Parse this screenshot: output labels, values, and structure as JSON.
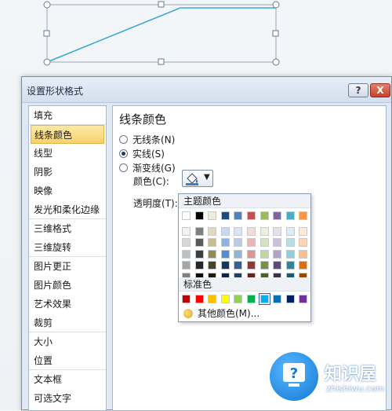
{
  "dialog": {
    "title": "设置形状格式",
    "help_label": "?",
    "close_label": "X"
  },
  "nav": {
    "items": [
      {
        "label": "填充"
      },
      {
        "label": "线条颜色",
        "active": true
      },
      {
        "label": "线型"
      },
      {
        "label": "阴影"
      },
      {
        "label": "映像"
      },
      {
        "label": "发光和柔化边缘"
      },
      {
        "label": "三维格式"
      },
      {
        "label": "三维旋转"
      },
      {
        "label": "图片更正"
      },
      {
        "label": "图片颜色"
      },
      {
        "label": "艺术效果"
      },
      {
        "label": "裁剪"
      },
      {
        "label": "大小"
      },
      {
        "label": "位置"
      },
      {
        "label": "文本框"
      },
      {
        "label": "可选文字"
      }
    ]
  },
  "panel": {
    "title": "线条颜色",
    "options": [
      {
        "label": "无线条(N)",
        "checked": false
      },
      {
        "label": "实线(S)",
        "checked": true
      },
      {
        "label": "渐变线(G)",
        "checked": false
      }
    ],
    "color_label": "颜色(C):",
    "transparency_label": "透明度(T):"
  },
  "palette": {
    "theme_header": "主题颜色",
    "standard_header": "标准色",
    "more_colors": "其他颜色(M)...",
    "theme_colors": [
      [
        "#ffffff",
        "#000000",
        "#eeece1",
        "#1f497d",
        "#4f81bd",
        "#c0504d",
        "#9bbb59",
        "#8064a2",
        "#4bacc6",
        "#f79646"
      ],
      [
        "#f2f2f2",
        "#7f7f7f",
        "#ddd9c3",
        "#c6d9f0",
        "#dbe5f1",
        "#f2dcdb",
        "#ebf1dd",
        "#e5e0ec",
        "#dbeef3",
        "#fdeada"
      ],
      [
        "#d8d8d8",
        "#595959",
        "#c4bd97",
        "#8db3e2",
        "#b8cce4",
        "#e5b9b7",
        "#d7e3bc",
        "#ccc1d9",
        "#b7dde8",
        "#fbd5b5"
      ],
      [
        "#bfbfbf",
        "#3f3f3f",
        "#938953",
        "#548dd4",
        "#95b3d7",
        "#d99694",
        "#c3d69b",
        "#b2a2c7",
        "#92cddc",
        "#fac08f"
      ],
      [
        "#a5a5a5",
        "#262626",
        "#494429",
        "#17365d",
        "#366092",
        "#953734",
        "#76923c",
        "#5f497a",
        "#31859b",
        "#e36c09"
      ],
      [
        "#7f7f7f",
        "#0c0c0c",
        "#1d1b10",
        "#0f243e",
        "#244061",
        "#632423",
        "#4f6128",
        "#3f3151",
        "#205867",
        "#974806"
      ]
    ],
    "standard_colors": [
      "#c00000",
      "#ff0000",
      "#ffc000",
      "#ffff00",
      "#92d050",
      "#00b050",
      "#00b0f0",
      "#0070c0",
      "#002060",
      "#7030a0"
    ],
    "selected_standard_index": 6
  },
  "watermark": {
    "brand": "知识屋",
    "site": "zhishiwu.com"
  }
}
